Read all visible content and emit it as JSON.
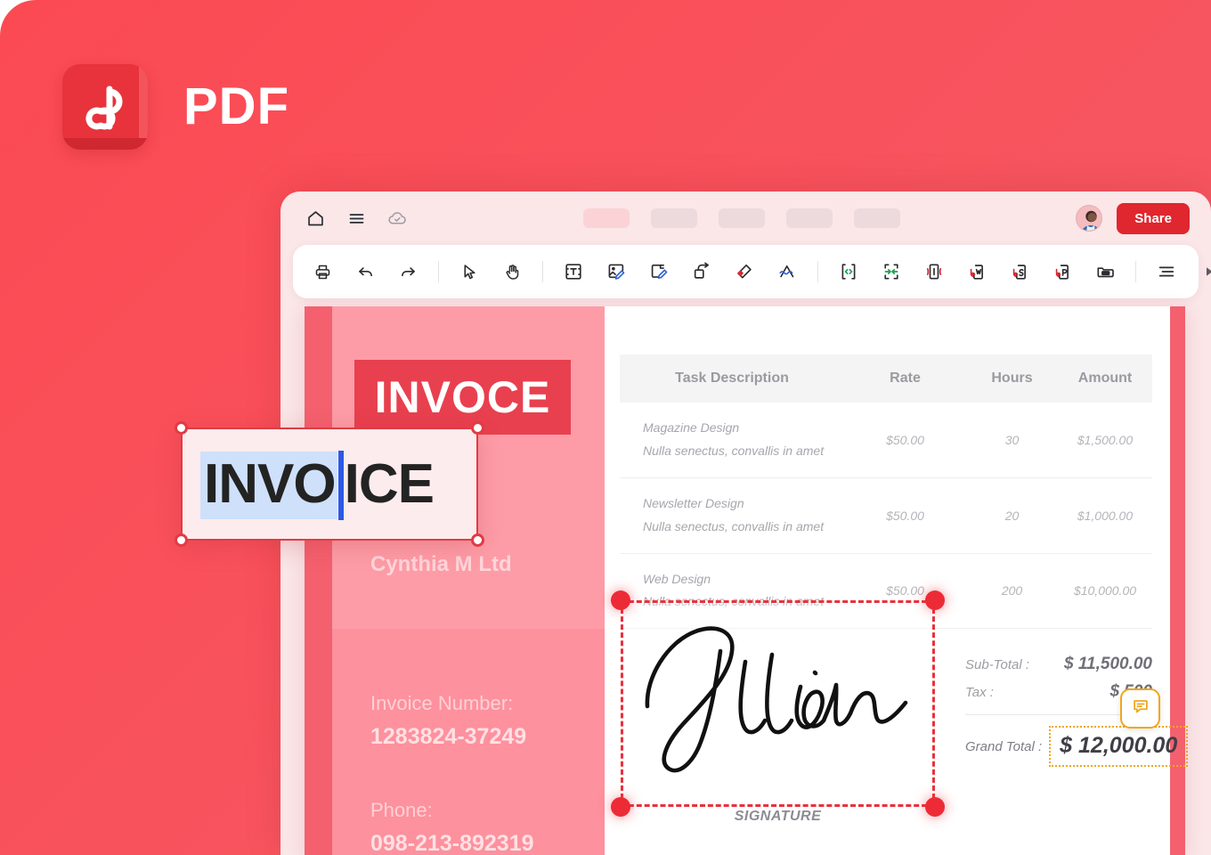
{
  "brand": {
    "wordmark": "PDF",
    "logo_icon": "pdf-infinity-logo-icon",
    "accent": "#e8333c",
    "backdrop": "#f9505b"
  },
  "app": {
    "title_bar": {
      "icons": [
        {
          "name": "home-icon"
        },
        {
          "name": "hamburger-menu-icon"
        },
        {
          "name": "cloud-saved-icon"
        }
      ],
      "tabs": [
        {
          "name": "tab-skeleton-1",
          "active": true
        },
        {
          "name": "tab-skeleton-2",
          "active": false
        },
        {
          "name": "tab-skeleton-3",
          "active": false
        },
        {
          "name": "tab-skeleton-4",
          "active": false
        },
        {
          "name": "tab-skeleton-5",
          "active": false
        }
      ],
      "avatar_alt": "user-avatar",
      "share_label": "Share",
      "share_color": "#e0262e"
    },
    "toolbar": [
      {
        "name": "print-icon"
      },
      {
        "name": "undo-icon"
      },
      {
        "name": "redo-icon"
      },
      {
        "separator": true
      },
      {
        "name": "select-cursor-icon"
      },
      {
        "name": "pan-hand-icon"
      },
      {
        "separator": true
      },
      {
        "name": "add-text-box-icon"
      },
      {
        "name": "edit-image-icon"
      },
      {
        "name": "edit-page-icon"
      },
      {
        "name": "add-link-icon"
      },
      {
        "name": "eraser-icon"
      },
      {
        "name": "signature-icon"
      },
      {
        "separator": true
      },
      {
        "name": "split-pages-icon"
      },
      {
        "name": "merge-pages-icon"
      },
      {
        "name": "compress-pdf-icon"
      },
      {
        "name": "convert-to-word-icon"
      },
      {
        "name": "convert-to-spreadsheet-icon"
      },
      {
        "name": "convert-to-powerpoint-icon"
      },
      {
        "name": "organize-pages-icon"
      },
      {
        "separator": true
      },
      {
        "name": "text-align-icon"
      },
      {
        "name": "more-tools-chevron-icon"
      }
    ]
  },
  "document": {
    "title_block": "INVOCE",
    "company": "Cynthia M Ltd",
    "fields": [
      {
        "label": "Invoice Number:",
        "value": "1283824-37249"
      },
      {
        "label": "Phone:",
        "value": "098-213-892319"
      }
    ],
    "table": {
      "headers": [
        "Task Description",
        "Rate",
        "Hours",
        "Amount"
      ],
      "rows": [
        {
          "title": "Magazine Design",
          "subtitle": "Nulla senectus, convallis in amet",
          "rate": "$50.00",
          "hours": "30",
          "amount": "$1,500.00"
        },
        {
          "title": "Newsletter Design",
          "subtitle": "Nulla senectus, convallis in amet",
          "rate": "$50.00",
          "hours": "20",
          "amount": "$1,000.00"
        },
        {
          "title": "Web Design",
          "subtitle": "Nulla senectus, convallis in amet",
          "rate": "$50.00",
          "hours": "200",
          "amount": "$10,000.00"
        }
      ]
    },
    "totals": {
      "subtotal_label": "Sub-Total :",
      "subtotal_value": "$ 11,500.00",
      "tax_label": "Tax :",
      "tax_value": "$ 500",
      "grand_total_label": "Grand Total :",
      "grand_total_value": "$ 12,000.00",
      "highlight_color": "#f0a61e"
    },
    "signature": {
      "name": "Jillian",
      "caption": "SIGNATURE",
      "selection_color": "#e8323c"
    }
  },
  "edit_overlay": {
    "selected_text": "INVO",
    "remaining_text": "ICE",
    "full_text": "INVOICE",
    "selection_color": "#cfe0fb",
    "caret_color": "#2b58e8",
    "border_color": "#e23b44"
  },
  "comment": {
    "icon": "comment-bubble-icon"
  }
}
